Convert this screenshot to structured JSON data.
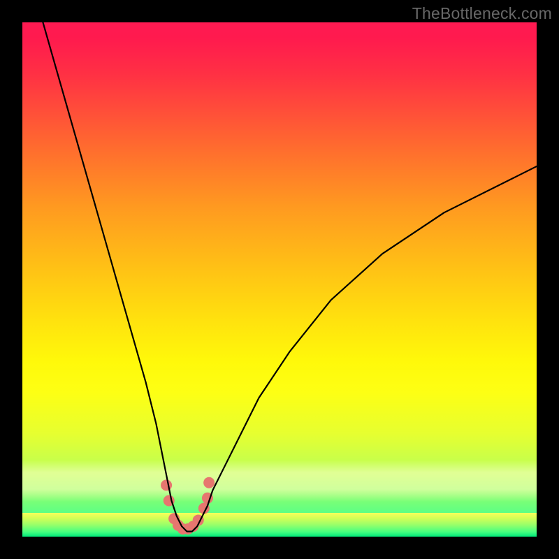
{
  "watermark": "TheBottleneck.com",
  "chart_data": {
    "type": "line",
    "title": "",
    "xlabel": "",
    "ylabel": "",
    "xlim": [
      0,
      100
    ],
    "ylim": [
      0,
      100
    ],
    "series": [
      {
        "name": "bottleneck-curve",
        "x": [
          4,
          6,
          8,
          10,
          12,
          14,
          16,
          18,
          20,
          22,
          24,
          26,
          27,
          28,
          29,
          30,
          31,
          32,
          33,
          34,
          35,
          36,
          37,
          39,
          42,
          46,
          52,
          60,
          70,
          82,
          96,
          100
        ],
        "y": [
          100,
          93,
          86,
          79,
          72,
          65,
          58,
          51,
          44,
          37,
          30,
          22,
          17,
          12,
          7,
          4,
          2,
          1,
          1,
          2,
          4,
          6,
          9,
          13,
          19,
          27,
          36,
          46,
          55,
          63,
          70,
          72
        ]
      }
    ],
    "markers": {
      "name": "curve-dots",
      "points": [
        {
          "x": 28.0,
          "y": 10.0
        },
        {
          "x": 28.5,
          "y": 7.0
        },
        {
          "x": 29.5,
          "y": 3.5
        },
        {
          "x": 30.3,
          "y": 2.2
        },
        {
          "x": 31.2,
          "y": 1.5
        },
        {
          "x": 32.2,
          "y": 1.5
        },
        {
          "x": 33.2,
          "y": 2.0
        },
        {
          "x": 34.2,
          "y": 3.2
        },
        {
          "x": 35.3,
          "y": 5.5
        },
        {
          "x": 36.0,
          "y": 7.5
        },
        {
          "x": 36.3,
          "y": 10.5
        }
      ],
      "color": "#e6766f",
      "radius_px": 8
    },
    "background_gradient": {
      "top": "#ff1a52",
      "mid": "#ffe20e",
      "bottom": "#00e97a"
    }
  }
}
